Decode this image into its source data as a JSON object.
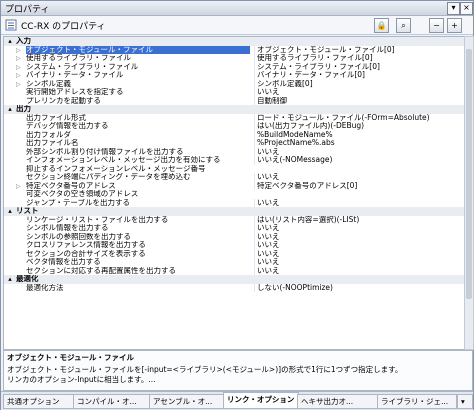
{
  "window": {
    "title": "プロパティ"
  },
  "toolbar": {
    "label": "CC-RX のプロパティ"
  },
  "categories": [
    {
      "label": "入力",
      "rows": [
        {
          "name": "オブジェクト・モジュール・ファイル",
          "value": "オブジェクト・モジュール・ファイル[0]",
          "selected": true,
          "expandable": true
        },
        {
          "name": "使用するライブラリ・ファイル",
          "value": "使用するライブラリ・ファイル[0]",
          "expandable": true
        },
        {
          "name": "システム・ライブラリ・ファイル",
          "value": "システム・ライブラリ・ファイル[0]",
          "expandable": true
        },
        {
          "name": "バイナリ・データ・ファイル",
          "value": "バイナリ・データ・ファイル[0]",
          "expandable": true
        },
        {
          "name": "シンボル定義",
          "value": "シンボル定義[0]",
          "expandable": true
        },
        {
          "name": "実行開始アドレスを指定する",
          "value": "いいえ"
        },
        {
          "name": "プレリンカを起動する",
          "value": "自動制御"
        }
      ]
    },
    {
      "label": "出力",
      "rows": [
        {
          "name": "出力ファイル形式",
          "value": "ロード・モジュール・ファイル(-FOrm=Absolute)"
        },
        {
          "name": "デバッグ情報を出力する",
          "value": "はい(出力ファイル内)(-DEBug)"
        },
        {
          "name": "出力フォルダ",
          "value": "%BuildModeName%"
        },
        {
          "name": "出力ファイル名",
          "value": "%ProjectName%.abs"
        },
        {
          "name": "外部シンボル割り付け情報ファイルを出力する",
          "value": "いいえ"
        },
        {
          "name": "インフォメーションレベル・メッセージ出力を有効にする",
          "value": "いいえ(-NOMessage)"
        },
        {
          "name": "抑止するインフォメーションレベル・メッセージ番号",
          "value": ""
        },
        {
          "name": "セクション終端にパディング・データを埋め込む",
          "value": "いいえ"
        },
        {
          "name": "特定ベクタ番号のアドレス",
          "value": "特定ベクタ番号のアドレス[0]",
          "expandable": true
        },
        {
          "name": "可変ベクタの空き領域のアドレス",
          "value": ""
        },
        {
          "name": "ジャンプ・テーブルを出力する",
          "value": "いいえ"
        }
      ]
    },
    {
      "label": "リスト",
      "rows": [
        {
          "name": "リンケージ・リスト・ファイルを出力する",
          "value": "はい(リスト内容=選択)(-LISt)"
        },
        {
          "name": "シンボル情報を出力する",
          "value": "いいえ"
        },
        {
          "name": "シンボルの参照回数を出力する",
          "value": "いいえ"
        },
        {
          "name": "クロスリファレンス情報を出力する",
          "value": "いいえ"
        },
        {
          "name": "セクションの合計サイズを表示する",
          "value": "いいえ"
        },
        {
          "name": "ベクタ情報を出力する",
          "value": "いいえ"
        },
        {
          "name": "セクションに対応する再配置属性を出力する",
          "value": "いいえ"
        }
      ]
    },
    {
      "label": "最適化",
      "rows": [
        {
          "name": "最適化方法",
          "value": "しない(-NOOPtimize)"
        }
      ]
    }
  ],
  "description": {
    "title": "オブジェクト・モジュール・ファイル",
    "line1": "オブジェクト・モジュール・ファイルを[-input=<ライブラリ>(<モジュール>)]の形式で1行に1つずつ指定します。",
    "line2": "リンカのオプション-Inputに相当します。..."
  },
  "tabs": [
    {
      "label": "共通オプション",
      "active": false
    },
    {
      "label": "コンパイル・オ...",
      "active": false
    },
    {
      "label": "アセンブル・オ...",
      "active": false
    },
    {
      "label": "リンク・オプション",
      "active": true
    },
    {
      "label": "ヘキサ出力オ...",
      "active": false
    },
    {
      "label": "ライブラリ・ジェ...",
      "active": false
    }
  ],
  "icons": [
    "properties-icon",
    "lock-icon",
    "search-icon",
    "minimize-icon",
    "close-icon",
    "collapse-icon",
    "expand-icon"
  ]
}
